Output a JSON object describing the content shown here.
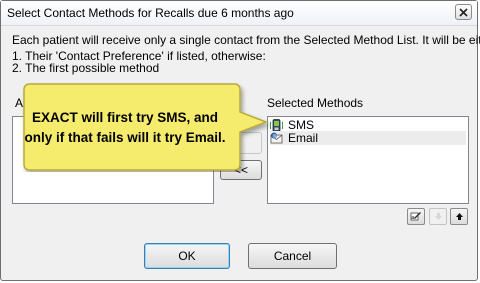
{
  "window": {
    "title": "Select Contact Methods for Recalls due 6 months ago"
  },
  "instructions": {
    "line1": "Each patient will receive only a single contact from the Selected Method List. It will be either;",
    "line2": "1. Their 'Contact Preference' if listed, otherwise:",
    "line3": "2. The first possible method"
  },
  "available": {
    "label_visible": "A"
  },
  "selected": {
    "label": "Selected Methods",
    "items": [
      {
        "label": "SMS",
        "icon": "phone-icon"
      },
      {
        "label": "Email",
        "icon": "email-icon"
      }
    ]
  },
  "transfer": {
    "remove_label": "<<"
  },
  "callout": {
    "text": "EXACT will first try SMS, and only if that fails will it try Email."
  },
  "footer": {
    "ok_label": "OK",
    "cancel_label": "Cancel"
  },
  "colors": {
    "callout_fill": "#f5eb6d",
    "callout_stroke": "#b9a93a",
    "default_button_border": "#3c7fb1"
  }
}
